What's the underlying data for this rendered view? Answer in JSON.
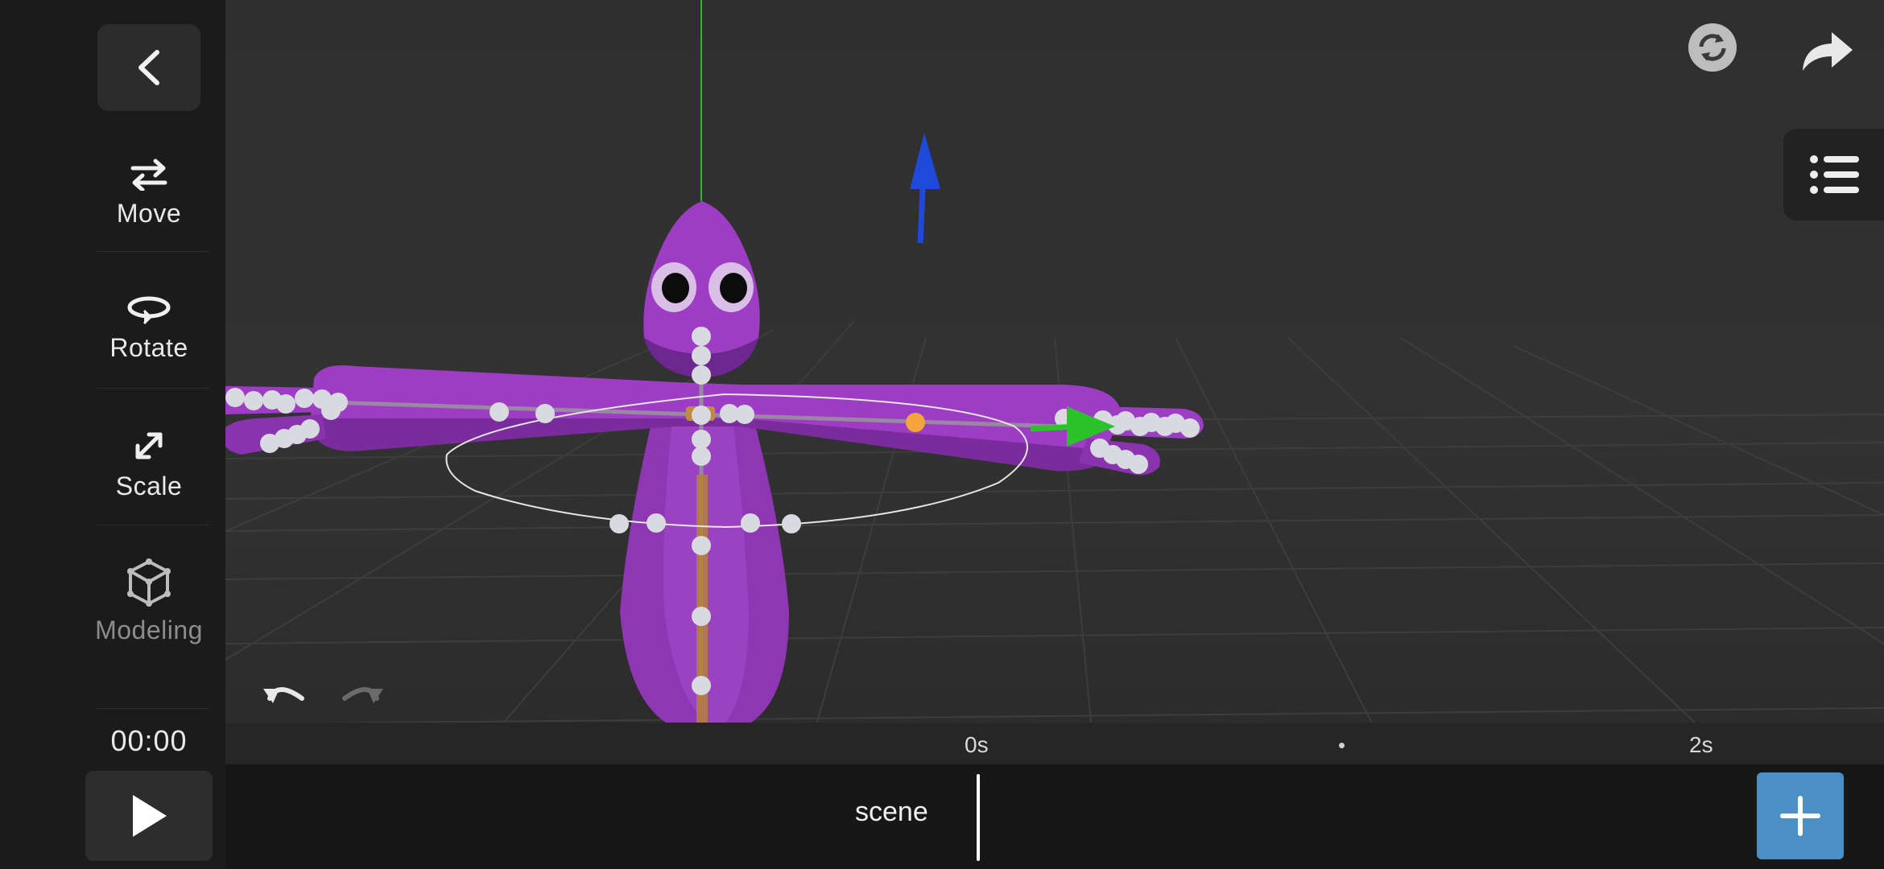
{
  "toolbar": {
    "back_icon": "chevron-left-icon",
    "tools": [
      {
        "label": "Move",
        "icon": "move-arrows-icon"
      },
      {
        "label": "Rotate",
        "icon": "rotate-icon"
      },
      {
        "label": "Scale",
        "icon": "scale-icon"
      },
      {
        "label": "Modeling",
        "icon": "cube-icon",
        "disabled": true
      }
    ],
    "time": "00:00",
    "play_icon": "play-icon"
  },
  "viewport": {
    "sync_icon": "sync-icon",
    "redo_share_icon": "forward-arrow-icon",
    "outliner_icon": "list-icon",
    "undo_icon": "undo-icon",
    "redo_icon": "redo-icon",
    "colors": {
      "model": "#9b3cc0",
      "joint": "#d9d9e0",
      "selected_joint": "#f5a33c",
      "gizmo_up": "#1f49d8",
      "gizmo_forward": "#2cc22c",
      "axis_line": "#22c022"
    }
  },
  "timeline": {
    "ticks": [
      {
        "label": "0s"
      },
      {
        "label": "2s"
      }
    ],
    "track": "scene",
    "add_icon": "plus-icon",
    "accent": "#4a90c4"
  }
}
